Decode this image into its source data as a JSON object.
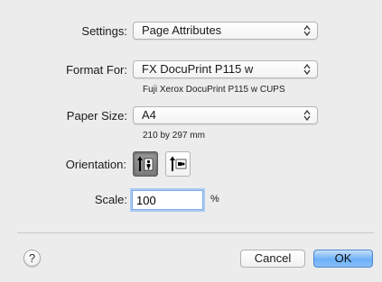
{
  "settings": {
    "label": "Settings:",
    "value": "Page Attributes"
  },
  "format_for": {
    "label": "Format For:",
    "value": "FX DocuPrint P115 w",
    "note": "Fuji Xerox DocuPrint P115 w CUPS"
  },
  "paper_size": {
    "label": "Paper Size:",
    "value": "A4",
    "note": "210 by 297 mm"
  },
  "orientation": {
    "label": "Orientation:",
    "options": [
      "portrait",
      "landscape"
    ],
    "selected": "portrait"
  },
  "scale": {
    "label": "Scale:",
    "value": "100",
    "unit": "%"
  },
  "buttons": {
    "help": "?",
    "cancel": "Cancel",
    "ok": "OK"
  },
  "colors": {
    "ok_accent": "#6cb0f7",
    "focus_ring": "#a9cbf2"
  }
}
